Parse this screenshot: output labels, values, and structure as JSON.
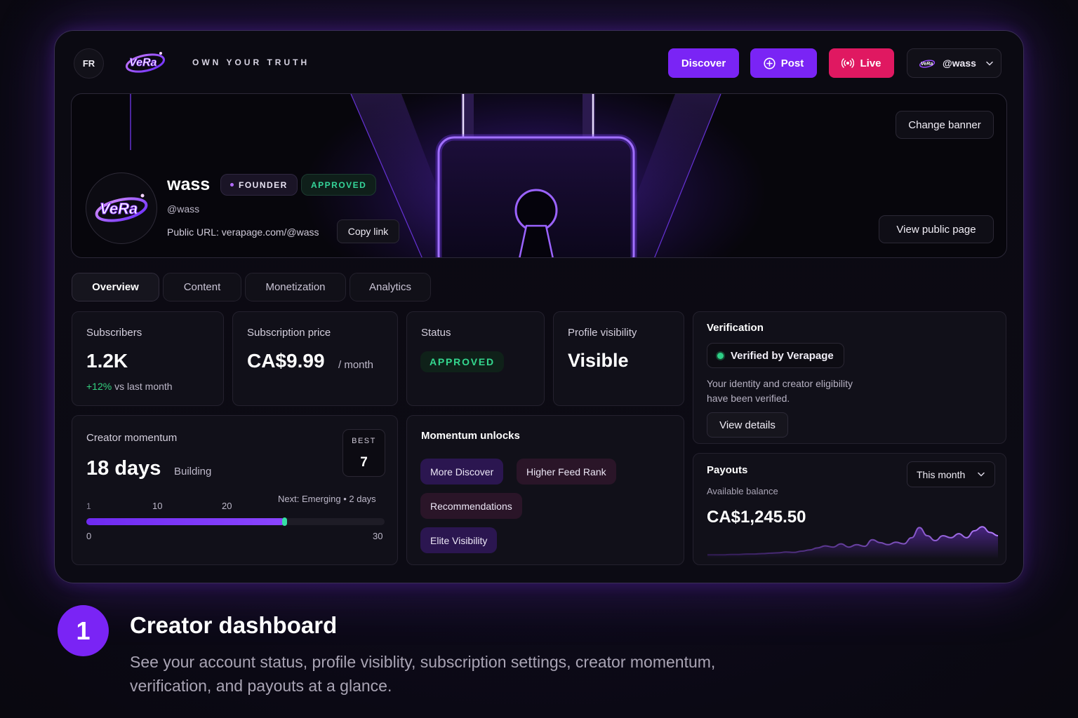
{
  "header": {
    "lang": "FR",
    "logo_text": "VeRa",
    "tagline": "OWN YOUR TRUTH",
    "discover_label": "Discover",
    "post_label": "Post",
    "live_label": "Live",
    "user_label": "@wass"
  },
  "profile": {
    "name": "wass",
    "founder_badge": "FOUNDER",
    "approved_badge": "APPROVED",
    "handle": "@wass",
    "public_url": "Public URL: verapage.com/@wass",
    "copy_link_label": "Copy link",
    "change_banner_label": "Change banner",
    "view_public_label": "View public page"
  },
  "tabs": [
    {
      "label": "Overview",
      "active": true
    },
    {
      "label": "Content",
      "active": false
    },
    {
      "label": "Monetization",
      "active": false
    },
    {
      "label": "Analytics",
      "active": false
    }
  ],
  "stats": {
    "subscribers": {
      "label": "Subscribers",
      "value": "1.2K",
      "delta": "+12%",
      "delta_suffix": "vs last month"
    },
    "price": {
      "label": "Subscription price",
      "value": "CA$9.99",
      "unit": "/ month"
    },
    "status": {
      "label": "Status",
      "value": "APPROVED"
    },
    "visibility": {
      "label": "Profile visibility",
      "value": "Visible"
    }
  },
  "verification": {
    "title": "Verification",
    "badge": "Verified by Verapage",
    "description_line1": "Your identity and creator eligibility",
    "description_line2": "have been verified.",
    "details_label": "View details"
  },
  "momentum": {
    "title": "Creator momentum",
    "days": "18 days",
    "stage": "Building",
    "best_label": "BEST",
    "best_value": "7",
    "next": "Next: Emerging • 2 days",
    "scale_top": [
      "1",
      "10",
      "20"
    ],
    "scale_bottom": [
      "0",
      "30"
    ],
    "progress_value": 20,
    "progress_max": 30
  },
  "unlocks": {
    "title": "Momentum unlocks",
    "items": [
      "More Discover",
      "Higher Feed Rank",
      "Recommendations",
      "Elite Visibility"
    ]
  },
  "payouts": {
    "title": "Payouts",
    "period": "This month",
    "balance_label": "Available balance",
    "balance": "CA$1,245.50",
    "sparkline": [
      0.03,
      0.03,
      0.03,
      0.04,
      0.04,
      0.05,
      0.05,
      0.06,
      0.07,
      0.08,
      0.1,
      0.09,
      0.12,
      0.15,
      0.2,
      0.25,
      0.22,
      0.3,
      0.22,
      0.28,
      0.24,
      0.4,
      0.33,
      0.28,
      0.34,
      0.3,
      0.45,
      0.7,
      0.5,
      0.38,
      0.5,
      0.45,
      0.55,
      0.45,
      0.62,
      0.72,
      0.58,
      0.5
    ]
  },
  "footer": {
    "step": "1",
    "title": "Creator dashboard",
    "description": "See your account status, profile visiblity, subscription settings, creator momentum, verification, and payouts at a glance."
  },
  "colors": {
    "accent": "#7a24f5",
    "live": "#e01861",
    "success": "#34d27f"
  }
}
